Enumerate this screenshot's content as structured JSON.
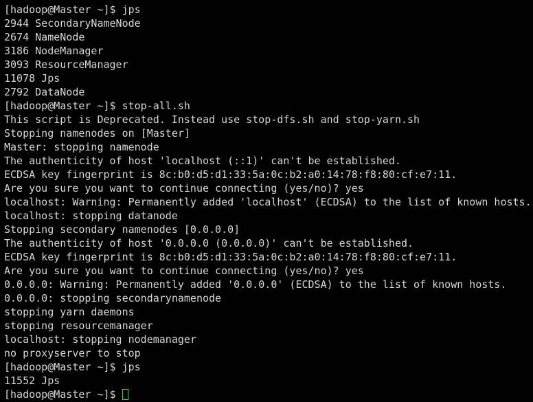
{
  "terminal": {
    "window_title": "hadoop@Master:~",
    "background_color": "#000000",
    "foreground_color": "#d6d6d6",
    "cursor_color": "#33dd33",
    "prompt": "[hadoop@Master ~]$ ",
    "font_size_px": 15,
    "line_height_px": 20,
    "columns": 84,
    "rows": 29,
    "lines": [
      {
        "type": "prompt",
        "prompt": "[hadoop@Master ~]$ ",
        "command": "jps"
      },
      {
        "type": "output",
        "text": "2944 SecondaryNameNode"
      },
      {
        "type": "output",
        "text": "2674 NameNode"
      },
      {
        "type": "output",
        "text": "3186 NodeManager"
      },
      {
        "type": "output",
        "text": "3093 ResourceManager"
      },
      {
        "type": "output",
        "text": "11078 Jps"
      },
      {
        "type": "output",
        "text": "2792 DataNode"
      },
      {
        "type": "prompt",
        "prompt": "[hadoop@Master ~]$ ",
        "command": "stop-all.sh"
      },
      {
        "type": "output",
        "text": "This script is Deprecated. Instead use stop-dfs.sh and stop-yarn.sh"
      },
      {
        "type": "output",
        "text": "Stopping namenodes on [Master]"
      },
      {
        "type": "output",
        "text": "Master: stopping namenode"
      },
      {
        "type": "output",
        "text": "The authenticity of host 'localhost (::1)' can't be established."
      },
      {
        "type": "output",
        "text": "ECDSA key fingerprint is 8c:b0:d5:d1:33:5a:0c:b2:a0:14:78:f8:80:cf:e7:11."
      },
      {
        "type": "output",
        "text": "Are you sure you want to continue connecting (yes/no)? yes"
      },
      {
        "type": "output",
        "text": "localhost: Warning: Permanently added 'localhost' (ECDSA) to the list of known hosts."
      },
      {
        "type": "output",
        "text": "localhost: stopping datanode"
      },
      {
        "type": "output",
        "text": "Stopping secondary namenodes [0.0.0.0]"
      },
      {
        "type": "output",
        "text": "The authenticity of host '0.0.0.0 (0.0.0.0)' can't be established."
      },
      {
        "type": "output",
        "text": "ECDSA key fingerprint is 8c:b0:d5:d1:33:5a:0c:b2:a0:14:78:f8:80:cf:e7:11."
      },
      {
        "type": "output",
        "text": "Are you sure you want to continue connecting (yes/no)? yes"
      },
      {
        "type": "output",
        "text": "0.0.0.0: Warning: Permanently added '0.0.0.0' (ECDSA) to the list of known hosts."
      },
      {
        "type": "output",
        "text": "0.0.0.0: stopping secondarynamenode"
      },
      {
        "type": "output",
        "text": "stopping yarn daemons"
      },
      {
        "type": "output",
        "text": "stopping resourcemanager"
      },
      {
        "type": "output",
        "text": "localhost: stopping nodemanager"
      },
      {
        "type": "output",
        "text": "no proxyserver to stop"
      },
      {
        "type": "prompt",
        "prompt": "[hadoop@Master ~]$ ",
        "command": "jps"
      },
      {
        "type": "output",
        "text": "11552 Jps"
      },
      {
        "type": "cursor",
        "prompt": "[hadoop@Master ~]$ ",
        "command": ""
      }
    ]
  }
}
